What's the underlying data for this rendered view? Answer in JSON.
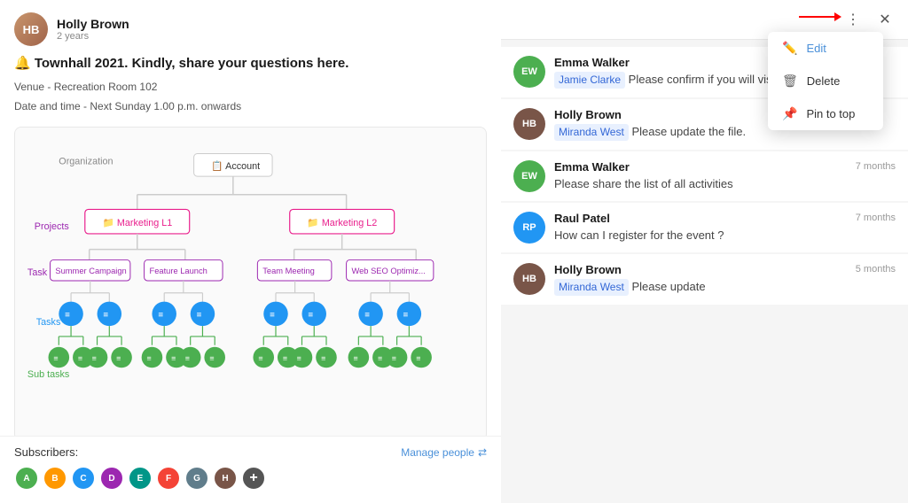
{
  "leftPanel": {
    "author": {
      "name": "Holly Brown",
      "sub": "2 years",
      "initials": "HB"
    },
    "postTitle": "🔔 Townhall 2021. Kindly, share your questions here.",
    "postDetails": [
      "Venue - Recreation Room 102",
      "Date and time - Next Sunday 1.00 p.m. onwards"
    ],
    "orgChart": {
      "orgLabel": "Organization",
      "accountLabel": "Account",
      "projectsLabel": "Projects",
      "taskListsLabel": "Task lists",
      "tasksLabel": "Tasks",
      "subTasksLabel": "Sub tasks",
      "marketing1": "Marketing L1",
      "marketing2": "Marketing L2",
      "taskLists": [
        "Summer Campaign",
        "Feature Launch",
        "Team Meeting",
        "Web SEO Optimization"
      ]
    },
    "subscribers": {
      "label": "Subscribers:",
      "manageLabel": "Manage people",
      "addLabel": "+"
    }
  },
  "rightPanel": {
    "topBar": {
      "moreIcon": "⋮",
      "closeIcon": "✕"
    },
    "contextMenu": {
      "items": [
        {
          "id": "edit",
          "icon": "✏️",
          "label": "Edit",
          "active": true
        },
        {
          "id": "delete",
          "icon": "🗑️",
          "label": "Delete",
          "active": false
        },
        {
          "id": "pin",
          "icon": "📌",
          "label": "Pin to top",
          "active": false
        }
      ]
    },
    "comments": [
      {
        "id": 1,
        "author": "Emma Walker",
        "initials": "EW",
        "avatarColor": "av-green",
        "time": "",
        "mention": "Jamie Clarke",
        "text": "Please confirm if you will visit?"
      },
      {
        "id": 2,
        "author": "Holly Brown",
        "initials": "HB",
        "avatarColor": "av-brown",
        "time": "",
        "mention": "Miranda West",
        "text": "Please update the file."
      },
      {
        "id": 3,
        "author": "Emma Walker",
        "initials": "EW",
        "avatarColor": "av-green",
        "time": "7 months",
        "mention": "",
        "text": "Please share the list of all activities"
      },
      {
        "id": 4,
        "author": "Raul Patel",
        "initials": "RP",
        "avatarColor": "av-blue",
        "time": "7 months",
        "mention": "",
        "text": "How can I register for the event ?"
      },
      {
        "id": 5,
        "author": "Holly Brown",
        "initials": "HB",
        "avatarColor": "av-brown",
        "time": "5 months",
        "mention": "Miranda West",
        "text": "Please update"
      }
    ]
  }
}
